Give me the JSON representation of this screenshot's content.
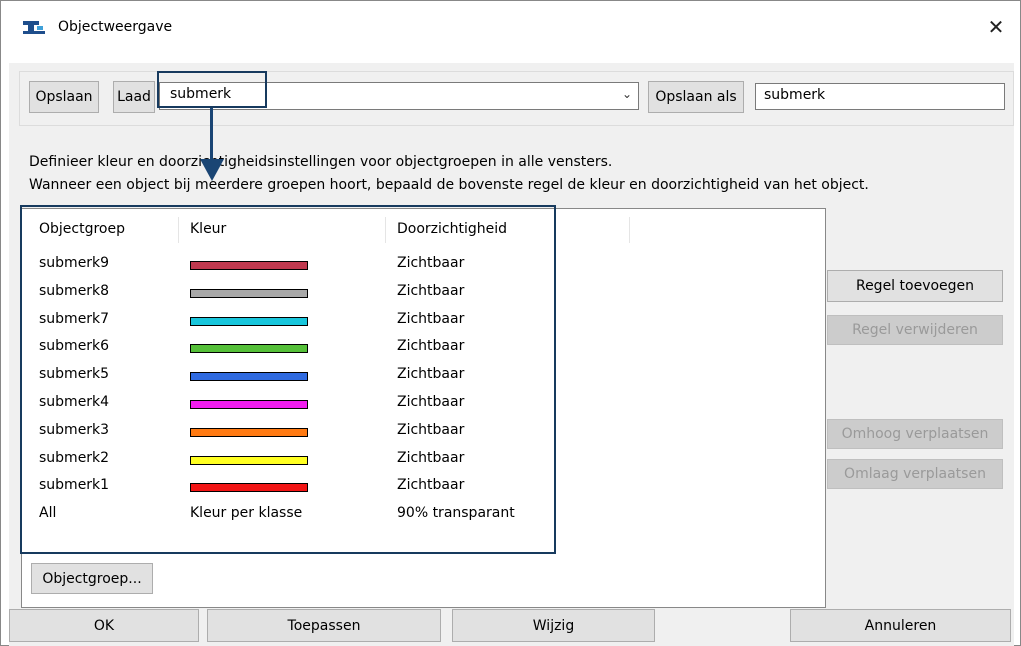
{
  "window": {
    "title": "Objectweergave",
    "close_label": "✕"
  },
  "toolbar": {
    "save_label": "Opslaan",
    "load_label": "Laad",
    "combo_value": "submerk",
    "save_as_label": "Opslaan als",
    "save_as_value": "submerk"
  },
  "description": {
    "line1": "Definieer kleur en doorzichtigheidsinstellingen voor objectgroepen in alle vensters.",
    "line2": "Wanneer een object bij meerdere groepen hoort, bepaald de bovenste regel de kleur en doorzichtigheid van het object."
  },
  "table": {
    "headers": [
      "Objectgroep",
      "Kleur",
      "Doorzichtigheid"
    ],
    "rows": [
      {
        "group": "submerk9",
        "color": "#c0394f",
        "color_text": "",
        "visibility": "Zichtbaar"
      },
      {
        "group": "submerk8",
        "color": "#a8a8a8",
        "color_text": "",
        "visibility": "Zichtbaar"
      },
      {
        "group": "submerk7",
        "color": "#18c6dc",
        "color_text": "",
        "visibility": "Zichtbaar"
      },
      {
        "group": "submerk6",
        "color": "#55c039",
        "color_text": "",
        "visibility": "Zichtbaar"
      },
      {
        "group": "submerk5",
        "color": "#2f6ae0",
        "color_text": "",
        "visibility": "Zichtbaar"
      },
      {
        "group": "submerk4",
        "color": "#f21df0",
        "color_text": "",
        "visibility": "Zichtbaar"
      },
      {
        "group": "submerk3",
        "color": "#ff7a12",
        "color_text": "",
        "visibility": "Zichtbaar"
      },
      {
        "group": "submerk2",
        "color": "#ffff22",
        "color_text": "",
        "visibility": "Zichtbaar"
      },
      {
        "group": "submerk1",
        "color": "#f21414",
        "color_text": "",
        "visibility": "Zichtbaar"
      },
      {
        "group": "All",
        "color": "",
        "color_text": "Kleur per klasse",
        "visibility": "90% transparant"
      }
    ]
  },
  "side_buttons": {
    "add_rule": "Regel toevoegen",
    "remove_rule": "Regel verwijderen",
    "move_up": "Omhoog verplaatsen",
    "move_down": "Omlaag verplaatsen"
  },
  "objectgroup_button": "Objectgroep...",
  "footer": {
    "ok": "OK",
    "apply": "Toepassen",
    "change": "Wijzig",
    "cancel": "Annuleren"
  },
  "annotation_color": "#173a5e"
}
